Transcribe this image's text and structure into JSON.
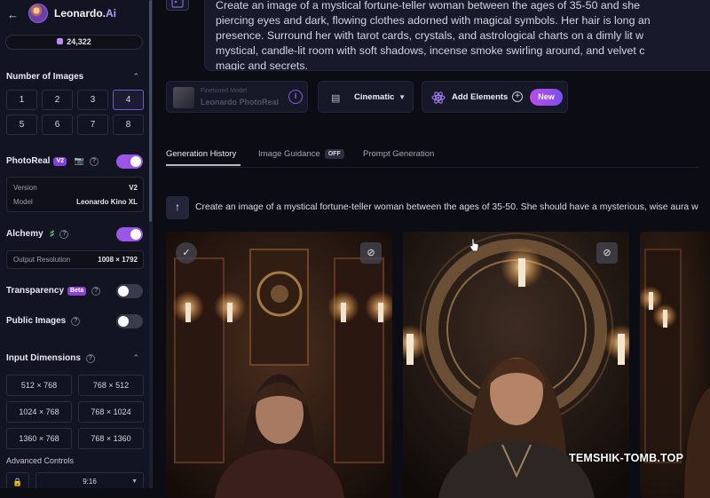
{
  "app": {
    "name_main": "Leonardo.",
    "name_accent": "Ai",
    "tokens": "24,322"
  },
  "sidebar": {
    "number_of_images": {
      "title": "Number of Images",
      "options": [
        "1",
        "2",
        "3",
        "4",
        "5",
        "6",
        "7",
        "8"
      ],
      "selected": "4"
    },
    "photoreal": {
      "label": "PhotoReal",
      "badge": "V2",
      "enabled": true,
      "version_label": "Version",
      "version_value": "V2",
      "model_label": "Model",
      "model_value": "Leonardo Kino XL"
    },
    "alchemy": {
      "label": "Alchemy",
      "enabled": true,
      "output_label": "Output Resolution",
      "output_value": "1008 × 1792"
    },
    "transparency": {
      "label": "Transparency",
      "badge": "Beta",
      "enabled": false
    },
    "public_images": {
      "label": "Public Images",
      "enabled": false
    },
    "input_dimensions": {
      "title": "Input Dimensions",
      "options": [
        "512 × 768",
        "768 × 512",
        "1024 × 768",
        "768 × 1024",
        "1360 × 768",
        "768 × 1360"
      ]
    },
    "advanced_controls": {
      "title": "Advanced Controls",
      "ratio": "9:16"
    }
  },
  "prompt": {
    "lines": [
      "Create an image of a mystical fortune-teller woman between the ages of 35-50 and she",
      "piercing eyes and dark, flowing clothes adorned with magical symbols. Her hair is long an",
      "presence. Surround her with tarot cards, crystals, and astrological charts on a dimly lit w",
      "mystical, candle-lit room with soft shadows, incense smoke swirling around, and velvet c",
      "magic and secrets."
    ]
  },
  "toolbar": {
    "model_caption": "Finetuned Model",
    "model_name": "Leonardo PhotoReal",
    "style": "Cinematic",
    "add_elements": "Add Elements",
    "new_badge": "New"
  },
  "tabs": [
    {
      "label": "Generation History",
      "active": true
    },
    {
      "label": "Image Guidance",
      "badge": "OFF",
      "active": false
    },
    {
      "label": "Prompt Generation",
      "active": false
    }
  ],
  "history": {
    "prompt_preview": "Create an image of a mystical fortune-teller woman between the ages of 35-50. She should have a mysterious, wise aura w"
  },
  "watermark": "TEMSHIK-TOMB.TOP",
  "colors": {
    "accent": "#9b55e8",
    "background": "#0b0c14",
    "sidebar": "#121421"
  }
}
